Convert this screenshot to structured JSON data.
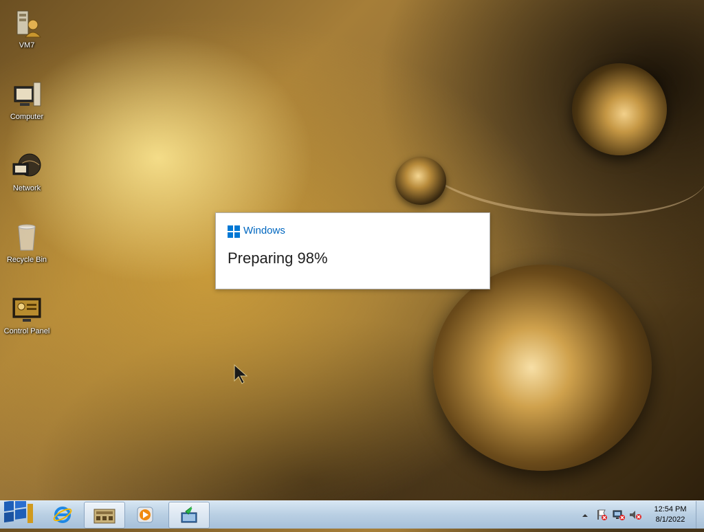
{
  "desktop": {
    "icons": [
      {
        "label": "VM7",
        "icon": "user-folder-icon"
      },
      {
        "label": "Computer",
        "icon": "computer-icon"
      },
      {
        "label": "Network",
        "icon": "network-icon"
      },
      {
        "label": "Recycle Bin",
        "icon": "recycle-bin-icon"
      },
      {
        "label": "Control Panel",
        "icon": "control-panel-icon"
      }
    ]
  },
  "dialog": {
    "brand": "Windows",
    "status": "Preparing 98%",
    "progress_percent": 98,
    "accent_color": "#0078d4"
  },
  "taskbar": {
    "start_icon": "windows-start-orb-icon",
    "pinned": [
      {
        "icon": "internet-explorer-icon"
      },
      {
        "icon": "file-explorer-icon"
      },
      {
        "icon": "media-player-icon"
      },
      {
        "icon": "installer-icon"
      }
    ],
    "tray": {
      "icons": [
        "show-hidden-icons-chevron",
        "action-center-flag-icon",
        "network-error-icon",
        "volume-muted-icon"
      ]
    },
    "clock": {
      "time": "12:54 PM",
      "date": "8/1/2022"
    }
  }
}
